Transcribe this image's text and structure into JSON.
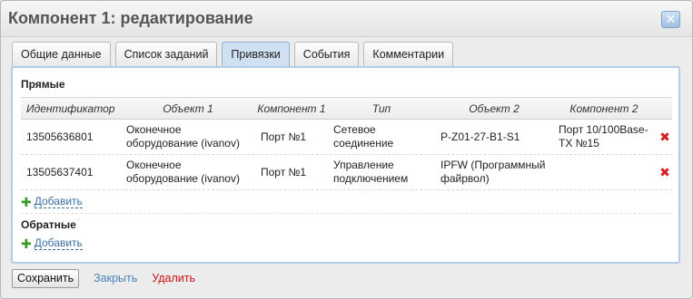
{
  "dialog": {
    "title": "Компонент 1: редактирование",
    "close_symbol": "✕"
  },
  "tabs": [
    {
      "label": "Общие данные",
      "active": false
    },
    {
      "label": "Список заданий",
      "active": false
    },
    {
      "label": "Привязки",
      "active": true
    },
    {
      "label": "События",
      "active": false
    },
    {
      "label": "Комментарии",
      "active": false
    }
  ],
  "direct": {
    "title": "Прямые",
    "columns": [
      "Идентификатор",
      "Объект 1",
      "Компонент 1",
      "Тип",
      "Объект 2",
      "Компонент 2"
    ],
    "rows": [
      {
        "id": "13505636801",
        "object1": "Оконечное оборудование (ivanov)",
        "component1": "Порт №1",
        "type": "Сетевое соединение",
        "object2": "P-Z01-27-B1-S1",
        "component2": "Порт 10/100Base-TX №15"
      },
      {
        "id": "13505637401",
        "object1": "Оконечное оборудование (ivanov)",
        "component1": "Порт №1",
        "type": "Управление подключением",
        "object2": "IPFW (Программный файрвол)",
        "component2": ""
      }
    ],
    "add_label": "Добавить"
  },
  "reverse": {
    "title": "Обратные",
    "add_label": "Добавить"
  },
  "footer": {
    "save_label": "Сохранить",
    "close_label": "Закрыть",
    "delete_label": "Удалить"
  },
  "icons": {
    "delete": "✖",
    "add": "✚"
  },
  "colors": {
    "active_tab": "#cfe0f2",
    "panel_border": "#b4cde6",
    "link": "#4a7fb8",
    "danger": "#cc1111",
    "add_icon": "#3b9a2a"
  }
}
